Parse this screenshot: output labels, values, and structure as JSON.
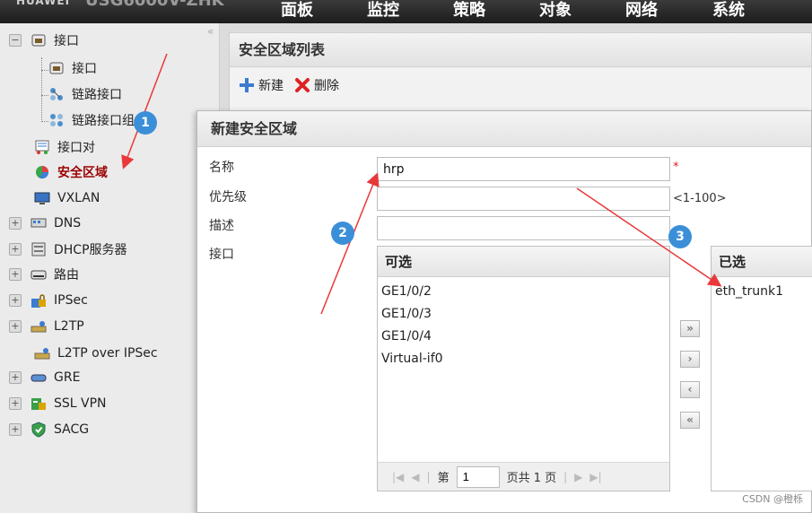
{
  "topbar": {
    "brand": "HUAWEI",
    "model": "USG6000V-ZHK",
    "nav": [
      "面板",
      "监控",
      "策略",
      "对象",
      "网络",
      "系统"
    ]
  },
  "sidebar": {
    "collapse_glyph": "«",
    "items": [
      {
        "label": "接口",
        "icon": "interface-icon",
        "expander": "−"
      },
      {
        "label": "接口",
        "icon": "interface-icon"
      },
      {
        "label": "链路接口",
        "icon": "link-interface-icon"
      },
      {
        "label": "链路接口组",
        "icon": "link-group-icon"
      },
      {
        "label": "接口对",
        "icon": "interface-pair-icon"
      },
      {
        "label": "安全区域",
        "icon": "security-zone-icon",
        "active": true
      },
      {
        "label": "VXLAN",
        "icon": "vxlan-icon"
      },
      {
        "label": "DNS",
        "icon": "dns-icon",
        "expander": "+"
      },
      {
        "label": "DHCP服务器",
        "icon": "dhcp-icon",
        "expander": "+"
      },
      {
        "label": "路由",
        "icon": "route-icon",
        "expander": "+"
      },
      {
        "label": "IPSec",
        "icon": "ipsec-icon",
        "expander": "+"
      },
      {
        "label": "L2TP",
        "icon": "l2tp-icon",
        "expander": "+"
      },
      {
        "label": "L2TP over IPSec",
        "icon": "l2tp-ipsec-icon"
      },
      {
        "label": "GRE",
        "icon": "gre-icon",
        "expander": "+"
      },
      {
        "label": "SSL VPN",
        "icon": "sslvpn-icon",
        "expander": "+"
      },
      {
        "label": "SACG",
        "icon": "sacg-icon",
        "expander": "+"
      }
    ]
  },
  "list_panel": {
    "title": "安全区域列表",
    "new_label": "新建",
    "delete_label": "删除"
  },
  "dialog": {
    "title": "新建安全区域",
    "name_label": "名称",
    "name_value": "hrp",
    "required_mark": "*",
    "priority_label": "优先级",
    "priority_value": "",
    "priority_hint": "<1-100>",
    "desc_label": "描述",
    "desc_value": "",
    "iface_label": "接口",
    "available": {
      "header": "可选",
      "items": [
        "GE1/0/2",
        "GE1/0/3",
        "GE1/0/4",
        "Virtual-if0"
      ]
    },
    "selected": {
      "header": "已选",
      "items": [
        "eth_trunk1"
      ]
    },
    "pager": {
      "page_prefix": "第",
      "page_value": "1",
      "page_suffix": "页共 1 页"
    },
    "move_buttons": [
      "»",
      "›",
      "‹",
      "«"
    ]
  },
  "callouts": [
    "1",
    "2",
    "3"
  ],
  "colors": {
    "arrow": "#e8383b",
    "callout": "#3b8fd8",
    "active_item": "#9b0000"
  },
  "watermark": "CSDN @橙栎"
}
